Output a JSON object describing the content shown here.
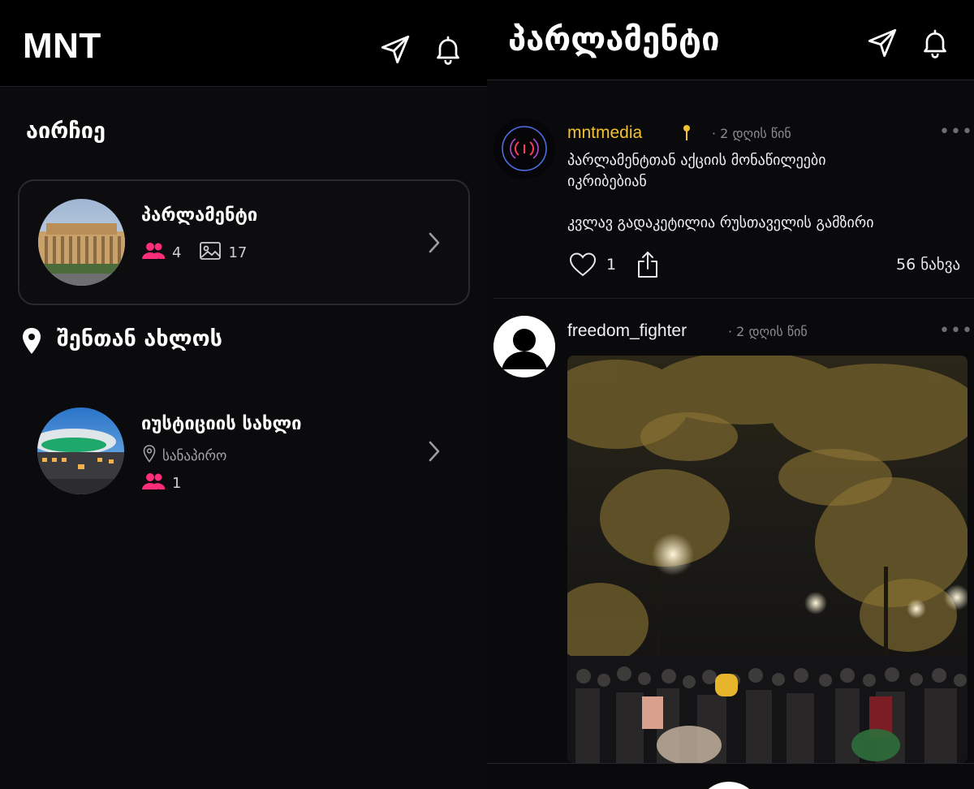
{
  "left": {
    "app_title": "MNT",
    "section_choose": "აირჩიე",
    "featured": {
      "name": "პარლამენტი",
      "members": "4",
      "photos": "17"
    },
    "section_nearby": "შენთან ახლოს",
    "nearby": {
      "name": "იუსტიციის სახლი",
      "location": "სანაპირო",
      "members": "1"
    }
  },
  "right": {
    "title": "პარლამენტი",
    "posts": [
      {
        "user": "mntmedia",
        "time": "· 2 დღის წინ",
        "text_line1": "პარლამენტთან აქციის მონაწილეები",
        "text_line2": "იკრიბებიან",
        "text_line3": "კვლავ გადაკეტილია რუსთაველის გამზირი",
        "likes": "1",
        "views": "56 ნახვა",
        "user_color": "#f2c230"
      },
      {
        "user": "freedom_fighter",
        "time": "· 2 დღის წინ"
      }
    ]
  },
  "colors": {
    "accent_pink": "#ff2d7a",
    "verified_yellow": "#f2c230"
  }
}
